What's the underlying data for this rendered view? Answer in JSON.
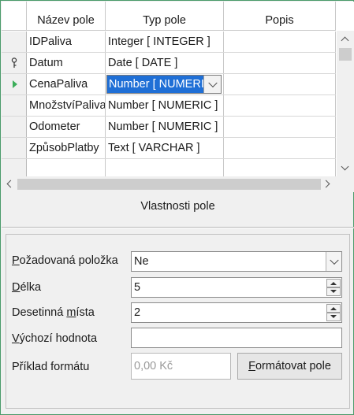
{
  "table": {
    "columns": [
      "Název pole",
      "Typ pole",
      "Popis"
    ],
    "rows": [
      {
        "name": "IDPaliva",
        "type": "Integer [ INTEGER ]",
        "desc": "",
        "marker": ""
      },
      {
        "name": "Datum",
        "type": "Date [ DATE ]",
        "desc": "",
        "marker": "key-icon"
      },
      {
        "name": "CenaPaliva",
        "type": "Number [ NUMERIC ]",
        "desc": "",
        "marker": "current-row-arrow-icon",
        "selected": true
      },
      {
        "name": "MnožstvíPaliva",
        "type": "Number [ NUMERIC ]",
        "desc": "",
        "marker": ""
      },
      {
        "name": "Odometer",
        "type": "Number [ NUMERIC ]",
        "desc": "",
        "marker": ""
      },
      {
        "name": "ZpůsobPlatby",
        "type": "Text [ VARCHAR ]",
        "desc": "",
        "marker": ""
      }
    ]
  },
  "properties": {
    "title": "Vlastnosti pole",
    "required": {
      "label_pre": "",
      "label_u": "P",
      "label_post": "ožadovaná položka",
      "value": "Ne"
    },
    "length": {
      "label_pre": "",
      "label_u": "D",
      "label_post": "élka",
      "value": "5"
    },
    "decimals": {
      "label_pre": "Desetinná ",
      "label_u": "m",
      "label_post": "ísta",
      "value": "2"
    },
    "default": {
      "label_pre": "",
      "label_u": "V",
      "label_post": "ýchozí hodnota",
      "value": ""
    },
    "format_example": {
      "label": "Příklad formátu",
      "value": "0,00 Kč"
    },
    "format_button": {
      "label_u": "F",
      "label_post": "ormátovat pole"
    }
  },
  "colors": {
    "selection": "#1f6fd6",
    "row_arrow": "#3cae5a",
    "window_border": "#4a9a6a"
  }
}
